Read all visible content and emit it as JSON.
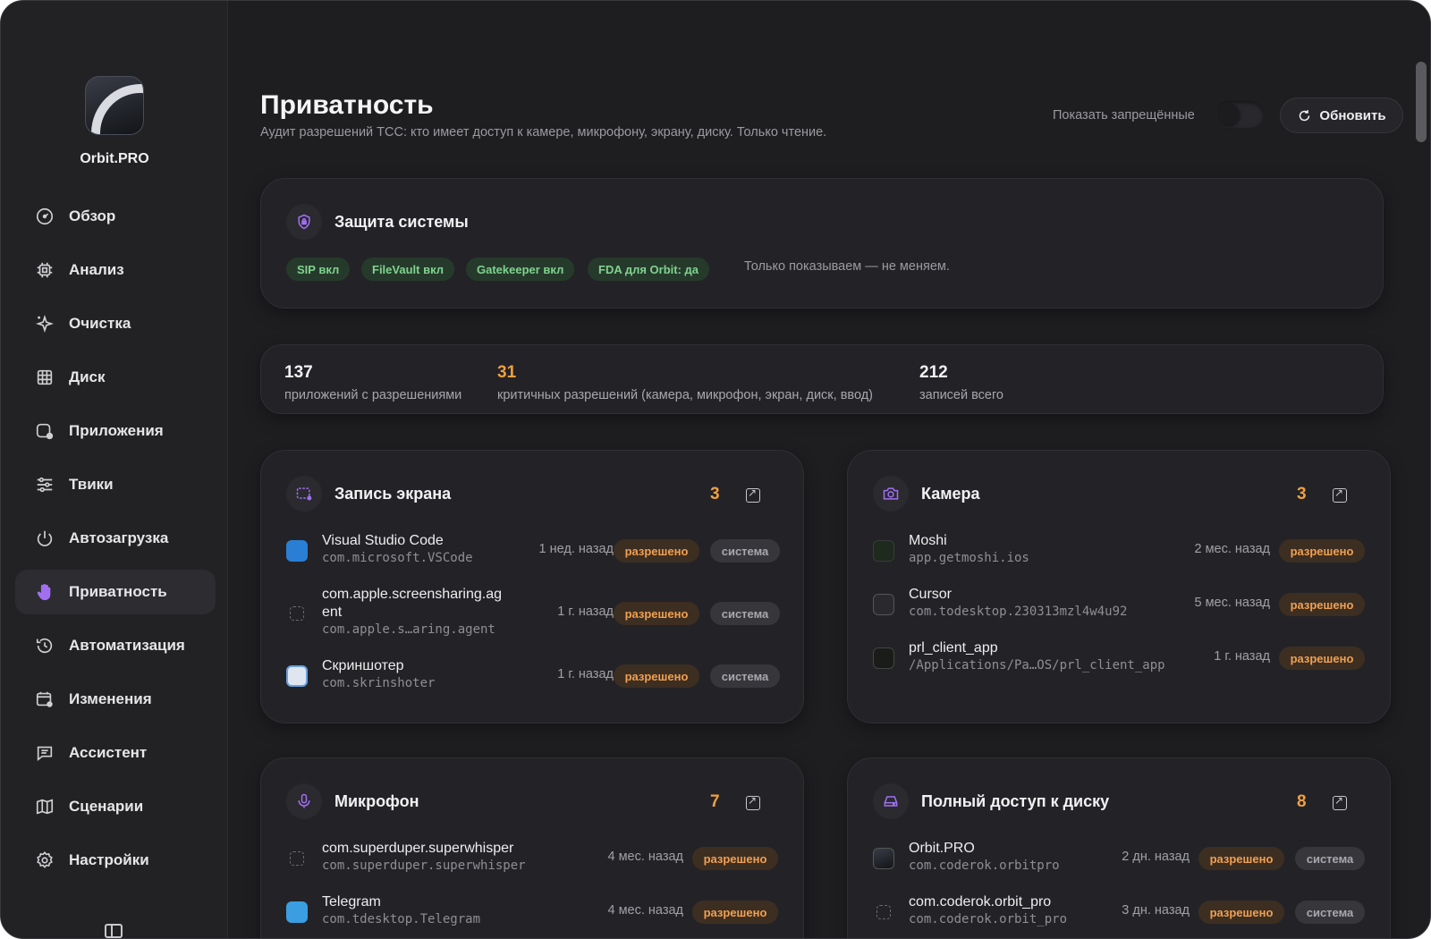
{
  "app": {
    "name": "Orbit.PRO"
  },
  "sidebar": {
    "items": [
      {
        "label": "Обзор",
        "icon": "gauge-icon"
      },
      {
        "label": "Анализ",
        "icon": "cpu-icon"
      },
      {
        "label": "Очистка",
        "icon": "sparkle-icon"
      },
      {
        "label": "Диск",
        "icon": "grid-icon"
      },
      {
        "label": "Приложения",
        "icon": "apps-icon"
      },
      {
        "label": "Твики",
        "icon": "sliders-icon"
      },
      {
        "label": "Автозагрузка",
        "icon": "power-icon"
      },
      {
        "label": "Приватность",
        "icon": "hand-icon",
        "active": true
      },
      {
        "label": "Автоматизация",
        "icon": "history-icon"
      },
      {
        "label": "Изменения",
        "icon": "calendar-icon"
      },
      {
        "label": "Ассистент",
        "icon": "chat-icon"
      },
      {
        "label": "Сценарии",
        "icon": "map-icon"
      },
      {
        "label": "Настройки",
        "icon": "gear-icon"
      }
    ]
  },
  "header": {
    "title": "Приватность",
    "subtitle": "Аудит разрешений TCC: кто имеет доступ к камере, микрофону, экрану, диску. Только чтение.",
    "show_denied_label": "Показать запрещённые",
    "refresh_label": "Обновить"
  },
  "system": {
    "title": "Защита системы",
    "chips": [
      "SIP вкл",
      "FileVault вкл",
      "Gatekeeper вкл",
      "FDA для Orbit: да"
    ],
    "note": "Только показываем — не меняем."
  },
  "stats": [
    {
      "value": "137",
      "label": "приложений с разрешениями",
      "accent": false
    },
    {
      "value": "31",
      "label": "критичных разрешений (камера, микрофон, экран, диск, ввод)",
      "accent": true
    },
    {
      "value": "212",
      "label": "записей всего",
      "accent": false
    }
  ],
  "colors": {
    "accent_orange": "#f0a040",
    "accent_purple": "#a070f0",
    "chip_green": "#7fd38e"
  },
  "cards": {
    "screen": {
      "title": "Запись экрана",
      "count": "3",
      "rows": [
        {
          "name": "Visual Studio Code",
          "id": "com.microsoft.VSCode",
          "time": "1 нед. назад",
          "status": "разрешено",
          "tag": "система",
          "icon": "vscode-icon"
        },
        {
          "name": "com.apple.screensharing.ag",
          "name2": "ent",
          "id": "com.apple.s…aring.agent",
          "time": "1 г. назад",
          "status": "разрешено",
          "tag": "система",
          "icon": "placeholder-icon"
        },
        {
          "name": "Скриншотер",
          "id": "com.skrinshoter",
          "time": "1 г. назад",
          "status": "разрешено",
          "tag": "система",
          "icon": "screenshot-app-icon"
        }
      ]
    },
    "camera": {
      "title": "Камера",
      "count": "3",
      "rows": [
        {
          "name": "Moshi",
          "id": "app.getmoshi.ios",
          "time": "2 мес. назад",
          "status": "разрешено",
          "icon": "moshi-icon"
        },
        {
          "name": "Cursor",
          "id": "com.todesktop.230313mzl4w4u92",
          "time": "5 мес. назад",
          "status": "разрешено",
          "icon": "cursor-icon"
        },
        {
          "name": "prl_client_app",
          "id": "/Applications/Pa…OS/prl_client_app",
          "time": "1 г. назад",
          "status": "разрешено",
          "icon": "terminal-icon"
        }
      ]
    },
    "mic": {
      "title": "Микрофон",
      "count": "7",
      "rows": [
        {
          "name": "com.superduper.superwhisper",
          "id": "com.superduper.superwhisper",
          "time": "4 мес. назад",
          "status": "разрешено",
          "icon": "placeholder-icon"
        },
        {
          "name": "Telegram",
          "id": "com.tdesktop.Telegram",
          "time": "4 мес. назад",
          "status": "разрешено",
          "icon": "telegram-icon"
        }
      ]
    },
    "disk": {
      "title": "Полный доступ к диску",
      "count": "8",
      "rows": [
        {
          "name": "Orbit.PRO",
          "id": "com.coderok.orbitpro",
          "time": "2 дн. назад",
          "status": "разрешено",
          "tag": "система",
          "icon": "orbit-icon"
        },
        {
          "name": "com.coderok.orbit_pro",
          "id": "com.coderok.orbit_pro",
          "time": "3 дн. назад",
          "status": "разрешено",
          "tag": "система",
          "icon": "placeholder-icon"
        }
      ]
    }
  }
}
